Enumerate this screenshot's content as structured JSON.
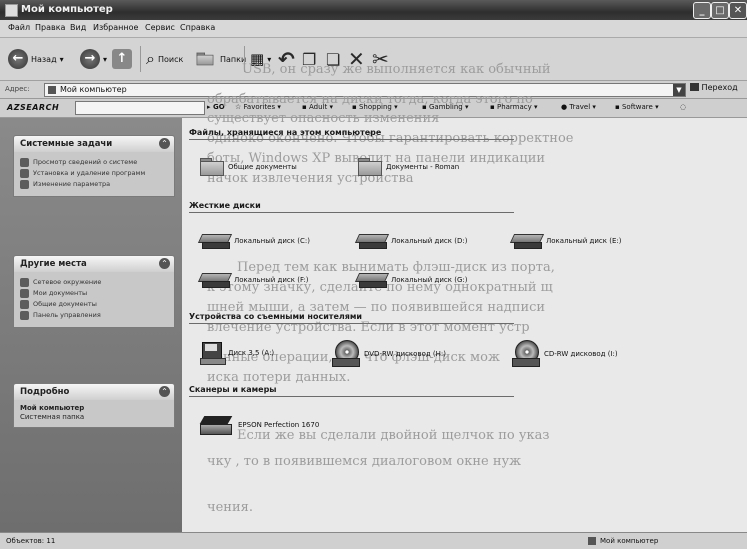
{
  "window": {
    "title": "Мой компьютер"
  },
  "menu": [
    "Файл",
    "Правка",
    "Вид",
    "Избранное",
    "Сервис",
    "Справка"
  ],
  "toolbar": {
    "back": "Назад",
    "search": "Поиск",
    "folders": "Папки"
  },
  "address": {
    "label": "Адрес:",
    "value": "Мой компьютер",
    "go": "Переход"
  },
  "azbar": {
    "logo": "AZSEARCH",
    "go": "GO",
    "items": [
      "Favorites",
      "Adult",
      "Shopping",
      "Gambling",
      "Pharmacy",
      "Travel",
      "Software"
    ]
  },
  "sidebar": {
    "tasks": {
      "title": "Системные задачи",
      "items": [
        "Просмотр сведений о системе",
        "Установка и удаление программ",
        "Изменение параметра"
      ]
    },
    "places": {
      "title": "Другие места",
      "items": [
        "Сетевое окружение",
        "Мои документы",
        "Общие документы",
        "Панель управления"
      ]
    },
    "details": {
      "title": "Подробно",
      "name": "Мой компьютер",
      "type": "Системная папка"
    }
  },
  "main": {
    "files_header": "Файлы, хранящиеся на этом компьютере",
    "files": [
      "Общие документы",
      "Документы - Roman"
    ],
    "hdd_header": "Жесткие диски",
    "disks": [
      "Локальный диск (C:)",
      "Локальный диск (D:)",
      "Локальный диск (E:)",
      "Локальный диск (F:)",
      "Локальный диск (G:)"
    ],
    "removable_header": "Устройства со съемными носителями",
    "removable": [
      "Диск 3,5 (A:)",
      "DVD-RW дисковод (H:)",
      "CD-RW дисковод (I:)"
    ],
    "scanners_header": "Сканеры и камеры",
    "scanners": [
      "EPSON Perfection 1670"
    ]
  },
  "ghost_text": [
    "USB, он сразу же выполняется как обычный",
    "обрабатывается на диски тогда, когда этого по",
    "существует опасность изменения",
    "одиноко окончено. Чтобы гарантировать корректное",
    "боты, Windows XP выводит на панели индикации",
    "начок извлечения устройства",
    "Перед тем как вынимать флэш-диск из порта,",
    "к этому значку, сделайте по нему однократный щ",
    "шней мыши, а затем — по появившейся надписи",
    "влечение устройства. Если в этот момент устр",
    "ленные операции, так что флэш-диск мож",
    "иска потери данных.",
    "Если же вы сделали двойной щелчок по указ",
    "чку , то в появившемся диалоговом окне нуж",
    "чения."
  ],
  "status": {
    "left": "Объектов: 11",
    "right": "Мой компьютер"
  }
}
